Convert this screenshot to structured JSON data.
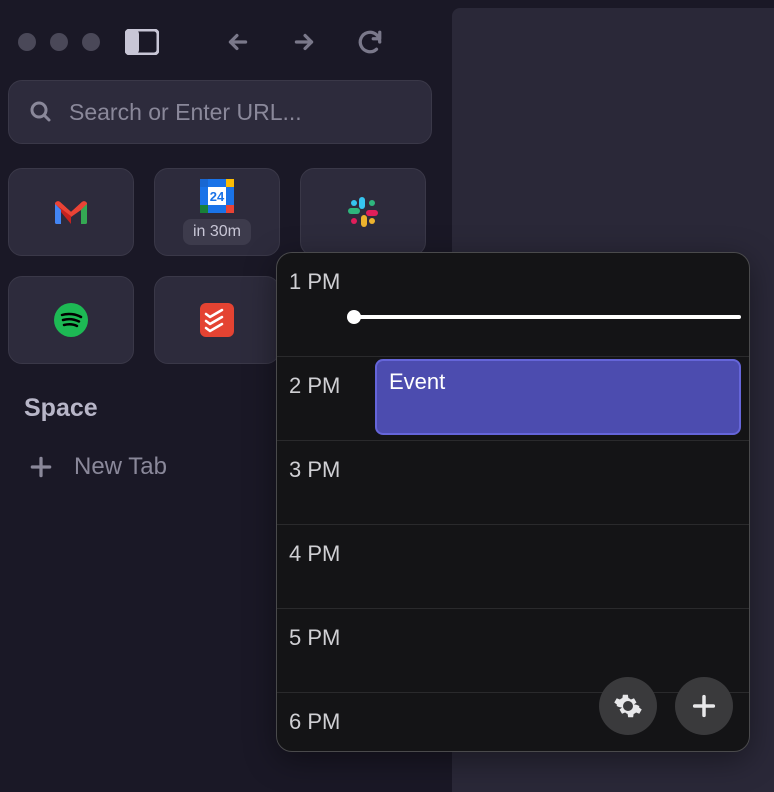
{
  "search": {
    "placeholder": "Search or Enter URL..."
  },
  "sidebar_toggle_icon": "sidebar-icon",
  "apps": [
    {
      "name": "gmail",
      "badge": null
    },
    {
      "name": "calendar",
      "badge": "in 30m"
    },
    {
      "name": "slack",
      "badge": null
    },
    {
      "name": "spotify",
      "badge": null
    },
    {
      "name": "todoist",
      "badge": null
    }
  ],
  "space_label": "Space",
  "new_tab_label": "New Tab",
  "calendar": {
    "hours": [
      "1 PM",
      "2 PM",
      "3 PM",
      "4 PM",
      "5 PM",
      "6 PM"
    ],
    "event_title": "Event"
  }
}
